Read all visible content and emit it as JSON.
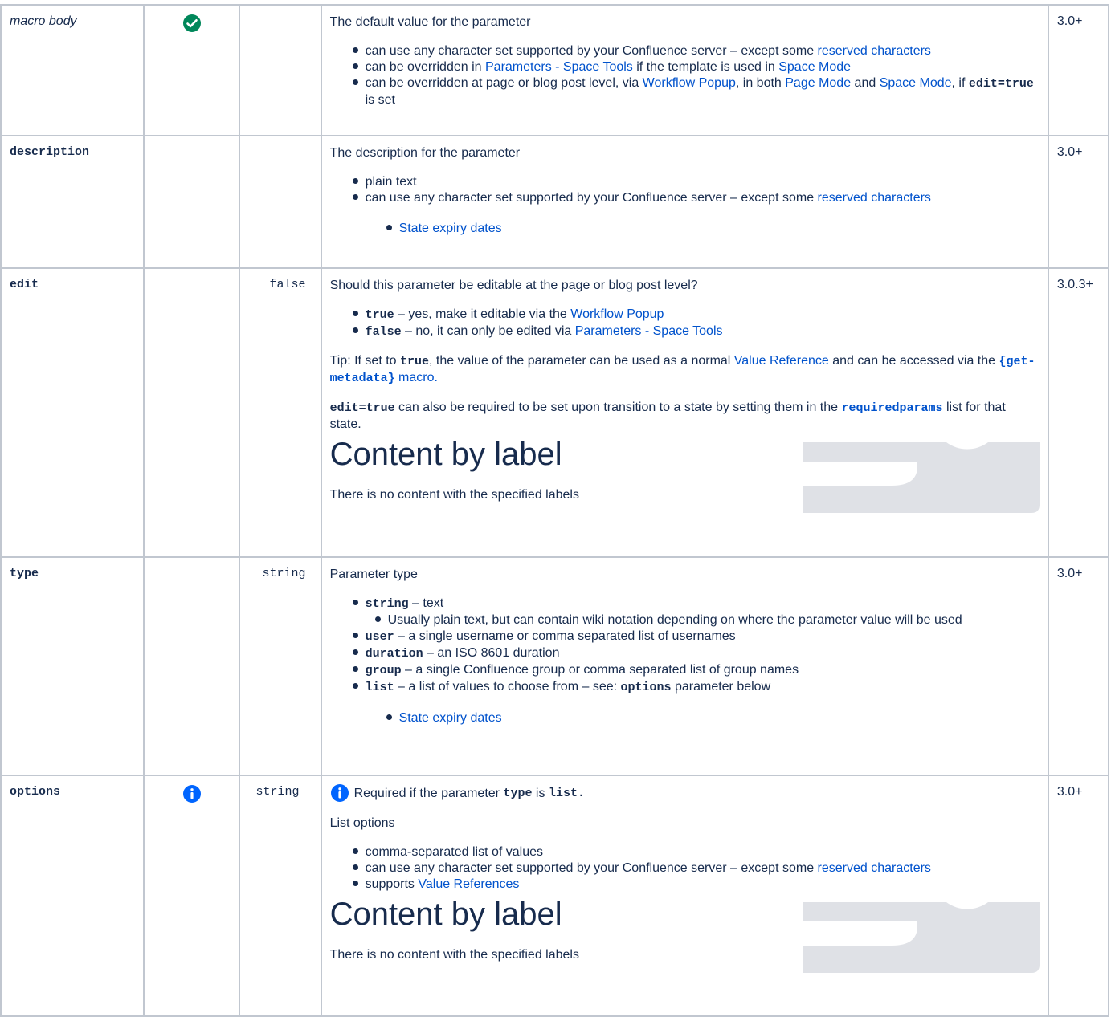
{
  "colors": {
    "link": "#0052cc",
    "text": "#172b4d",
    "border": "#c1c7d0",
    "check": "#00875a",
    "info": "#0065ff",
    "placeholder": "#dfe1e6"
  },
  "icons": {
    "required": "check-circle-icon",
    "note": "info-circle-icon"
  },
  "rows": [
    {
      "name": "macro body",
      "default": "",
      "version": "3.0+",
      "intro": "The default value for the parameter",
      "bullets": [
        {
          "pre": "can use any character set supported by your Confluence server – except some ",
          "link": "reserved characters"
        },
        {
          "pre": "can be overridden in ",
          "link1": "Parameters - Space Tools",
          "mid": " if the template is used in ",
          "link2": "Space Mode"
        },
        {
          "pre": "can be overridden at page or blog post level, via ",
          "link1": "Workflow Popup",
          "mid1": ", in both ",
          "link2": "Page Mode",
          "mid2": " and ",
          "link3": "Space Mode",
          "mid3": ", if ",
          "code": "edit=true",
          "post": " is set"
        }
      ]
    },
    {
      "name": "description",
      "default": "",
      "version": "3.0+",
      "intro": "The description for the parameter",
      "bullets": [
        {
          "text": "plain text"
        },
        {
          "pre": "can use any character set supported by your Confluence server – except some ",
          "link": "reserved characters"
        }
      ],
      "related": "State expiry dates"
    },
    {
      "name": "edit",
      "default": "false",
      "version": "3.0.3+",
      "intro": "Should this parameter be editable at the page or blog post level?",
      "bullets": [
        {
          "code": "true",
          "pre": " – yes, make it editable via the ",
          "link": "Workflow Popup"
        },
        {
          "code": "false",
          "pre": " – no, it can only be edited via ",
          "link": "Parameters - Space Tools"
        }
      ],
      "tip": {
        "pre": "Tip: If set to ",
        "code": "true",
        "mid": ", the value of the parameter can be used as a normal ",
        "link": "Value Reference",
        "mid2": " and can be accessed via the ",
        "macro": "{get-metadata}",
        "post": " macro."
      },
      "note": {
        "code": "edit=true",
        "pre": " can also be required to be set upon transition to a state by setting them in the ",
        "link": "requiredparams",
        "post": " list for that state."
      },
      "cbl_title": "Content by label",
      "cbl_msg": "There is no content with the specified labels"
    },
    {
      "name": "type",
      "default": "string",
      "version": "3.0+",
      "intro": "Parameter type",
      "bullets": [
        {
          "code": "string",
          "text": " – text",
          "sub": "Usually plain text, but can contain wiki notation depending on where the parameter value will be used"
        },
        {
          "code": "user",
          "text": " – a single username or comma separated list of usernames"
        },
        {
          "code": "duration",
          "text": " – an ISO 8601 duration"
        },
        {
          "code": "group",
          "text": " – a single Confluence group or comma separated list of group names"
        },
        {
          "code": "list",
          "text": " – a list of values to choose from – see: ",
          "code2": "options",
          "post": " parameter below"
        }
      ],
      "related": "State expiry dates"
    },
    {
      "name": "options",
      "default": "string",
      "version": "3.0+",
      "info": {
        "pre": "Required if the parameter ",
        "code": "type",
        "mid": " is ",
        "code2": "list."
      },
      "intro": "List options",
      "bullets": [
        {
          "text": "comma-separated list of values"
        },
        {
          "pre": "can use any character set supported by your Confluence server – except some ",
          "link": "reserved characters"
        },
        {
          "pre": "supports ",
          "link": "Value References"
        }
      ],
      "cbl_title": "Content by label",
      "cbl_msg": "There is no content with the specified labels"
    }
  ]
}
